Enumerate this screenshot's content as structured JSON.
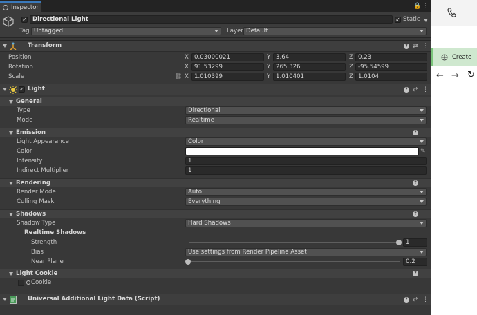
{
  "tab": {
    "title": "Inspector"
  },
  "object": {
    "name": "Directional Light",
    "static_label": "Static",
    "tag_label": "Tag",
    "tag_value": "Untagged",
    "layer_label": "Layer",
    "layer_value": "Default",
    "active": true,
    "static": true
  },
  "transform": {
    "title": "Transform",
    "position": {
      "label": "Position",
      "x": "0.03000021",
      "y": "3.64",
      "z": "0.23"
    },
    "rotation": {
      "label": "Rotation",
      "x": "91.53299",
      "y": "265.326",
      "z": "-95.54599"
    },
    "scale": {
      "label": "Scale",
      "x": "1.010399",
      "y": "1.010401",
      "z": "1.0104"
    },
    "axis": {
      "x": "X",
      "y": "Y",
      "z": "Z"
    }
  },
  "light": {
    "title": "Light",
    "general": {
      "title": "General",
      "type_label": "Type",
      "type_value": "Directional",
      "mode_label": "Mode",
      "mode_value": "Realtime"
    },
    "emission": {
      "title": "Emission",
      "appearance_label": "Light Appearance",
      "appearance_value": "Color",
      "color_label": "Color",
      "color_value": "#ffffff",
      "intensity_label": "Intensity",
      "intensity_value": "1",
      "indirect_label": "Indirect Multiplier",
      "indirect_value": "1"
    },
    "rendering": {
      "title": "Rendering",
      "render_mode_label": "Render Mode",
      "render_mode_value": "Auto",
      "culling_label": "Culling Mask",
      "culling_value": "Everything"
    },
    "shadows": {
      "title": "Shadows",
      "type_label": "Shadow Type",
      "type_value": "Hard Shadows",
      "realtime_title": "Realtime Shadows",
      "strength_label": "Strength",
      "strength_value": "1",
      "strength_fraction": 1.0,
      "bias_label": "Bias",
      "bias_value": "Use settings from Render Pipeline Asset",
      "near_label": "Near Plane",
      "near_value": "0.2",
      "near_fraction": 0.0
    },
    "cookie": {
      "title": "Light Cookie",
      "cookie_label": "Cookie"
    }
  },
  "urp": {
    "title": "Universal Additional Light Data (Script)"
  },
  "right_panel": {
    "create_label": "Create"
  },
  "colors": {
    "accent": "#3a79bb",
    "panel": "#383838",
    "selection": "#cfe8cf"
  }
}
